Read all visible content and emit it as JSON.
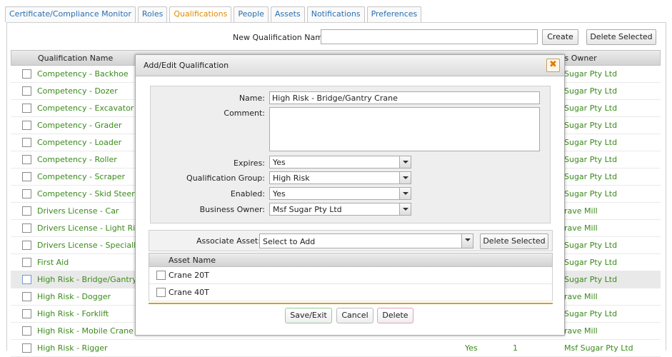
{
  "tabs": [
    {
      "label": "Certificate/Compliance Monitor",
      "active": false
    },
    {
      "label": "Roles",
      "active": false
    },
    {
      "label": "Qualifications",
      "active": true
    },
    {
      "label": "People",
      "active": false
    },
    {
      "label": "Assets",
      "active": false
    },
    {
      "label": "Notifications",
      "active": false
    },
    {
      "label": "Preferences",
      "active": false
    }
  ],
  "toolbar": {
    "new_label": "New Qualification Name:",
    "new_value": "",
    "create_label": "Create",
    "delete_label": "Delete Selected"
  },
  "grid": {
    "col_name": "Qualification Name",
    "col_owner": "ness Owner",
    "rows": [
      {
        "name": "Competency - Backhoe",
        "owner": "Sugar Pty Ltd",
        "selected": false
      },
      {
        "name": "Competency - Dozer",
        "owner": "Sugar Pty Ltd",
        "selected": false
      },
      {
        "name": "Competency - Excavator",
        "owner": "Sugar Pty Ltd",
        "selected": false
      },
      {
        "name": "Competency - Grader",
        "owner": "Sugar Pty Ltd",
        "selected": false
      },
      {
        "name": "Competency - Loader",
        "owner": "Sugar Pty Ltd",
        "selected": false
      },
      {
        "name": "Competency - Roller",
        "owner": "Sugar Pty Ltd",
        "selected": false
      },
      {
        "name": "Competency - Scraper",
        "owner": "Sugar Pty Ltd",
        "selected": false
      },
      {
        "name": "Competency - Skid Steer",
        "owner": "Sugar Pty Ltd",
        "selected": false
      },
      {
        "name": "Drivers License - Car",
        "owner": "rave Mill",
        "selected": false
      },
      {
        "name": "Drivers License - Light Rigid",
        "owner": "rave Mill",
        "selected": false
      },
      {
        "name": "Drivers License - Specially Co",
        "owner": "Sugar Pty Ltd",
        "selected": false
      },
      {
        "name": "First Aid",
        "owner": "Sugar Pty Ltd",
        "selected": false
      },
      {
        "name": "High Risk - Bridge/Gantry Cra",
        "owner": "Sugar Pty Ltd",
        "selected": true
      },
      {
        "name": "High Risk - Dogger",
        "owner": "rave Mill",
        "selected": false
      },
      {
        "name": "High Risk - Forklift",
        "owner": "Sugar Pty Ltd",
        "selected": false
      },
      {
        "name": "High Risk - Mobile Crane",
        "owner": "rave Mill",
        "selected": false
      },
      {
        "name": "High Risk - Rigger",
        "owner": "Msf Sugar Pty Ltd",
        "selected": false
      }
    ],
    "last_row_yes": "Yes",
    "last_row_count": "1"
  },
  "modal": {
    "title": "Add/Edit Qualification",
    "close_symbol": "✖",
    "name_label": "Name:",
    "name_value": "High Risk - Bridge/Gantry Crane",
    "comment_label": "Comment:",
    "comment_value": "",
    "expires_label": "Expires:",
    "expires_value": "Yes",
    "group_label": "Qualification Group:",
    "group_value": "High Risk",
    "enabled_label": "Enabled:",
    "enabled_value": "Yes",
    "owner_label": "Business Owner:",
    "owner_value": "Msf Sugar Pty Ltd",
    "assoc_label": "Associate Asset:",
    "assoc_value": "Select to Add",
    "assoc_delete": "Delete Selected",
    "asset_col": "Asset Name",
    "assets": [
      "Crane 20T",
      "Crane 40T"
    ],
    "save_label": "Save/Exit",
    "cancel_label": "Cancel",
    "delete_label": "Delete"
  },
  "colors": {
    "link_green": "#3a8a1a",
    "tab_blue": "#2a6fb0",
    "active_tab": "#e08a00",
    "accent_gold": "#d4a020"
  }
}
